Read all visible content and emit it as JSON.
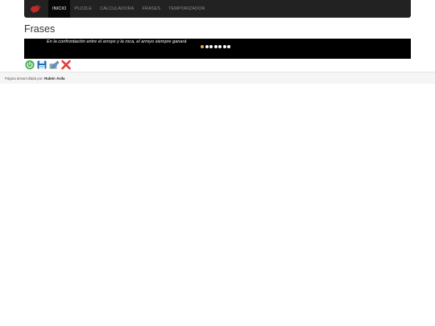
{
  "nav": {
    "items": [
      {
        "label": "INICIO",
        "active": true
      },
      {
        "label": "PUZZLE",
        "active": false
      },
      {
        "label": "CALCULADORA",
        "active": false
      },
      {
        "label": "FRASES",
        "active": false
      },
      {
        "label": "TEMPORIZADOR",
        "active": false
      }
    ]
  },
  "page": {
    "title": "Frases"
  },
  "carousel": {
    "quote": "En la confrontación entre el arroyo y la roca, el arroyo siempre ganará",
    "slide_count": 7,
    "active_slide": 1
  },
  "toolbar": {
    "icons": [
      "power-icon",
      "save-icon",
      "edit-icon",
      "delete-icon"
    ]
  },
  "footer": {
    "prefix": "Página desarrollada por:",
    "author": "Rubén Ávila"
  },
  "colors": {
    "navbar_bg": "#222222",
    "carousel_bg": "#000000",
    "indicator_active": "#f0ad4e",
    "power_icon": "#4caf50",
    "delete_icon": "#e53935"
  }
}
